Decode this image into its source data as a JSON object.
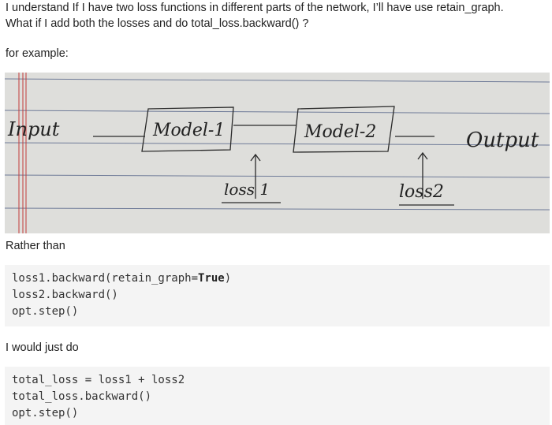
{
  "post": {
    "intro_line1": "I understand If I have two loss functions in different parts of the network, I’ll have use retain_graph.",
    "intro_line2": "What if I add both the losses and do total_loss.backward() ?",
    "for_example": "for example:",
    "rather_than": "Rather than",
    "would_just_do": "I would just do"
  },
  "diagram": {
    "input": "Input",
    "model1": "Model-1",
    "model2": "Model-2",
    "output": "Output",
    "loss1": "loss 1",
    "loss2": "loss2"
  },
  "code_block_1": {
    "line1_pre": "loss1.backward(retain_graph=",
    "line1_kw": "True",
    "line1_post": ")",
    "line2": "loss2.backward()",
    "line3": "opt.step()"
  },
  "code_block_2": {
    "line1": "total_loss = loss1 + loss2",
    "line2": "total_loss.backward()",
    "line3": "opt.step()"
  }
}
